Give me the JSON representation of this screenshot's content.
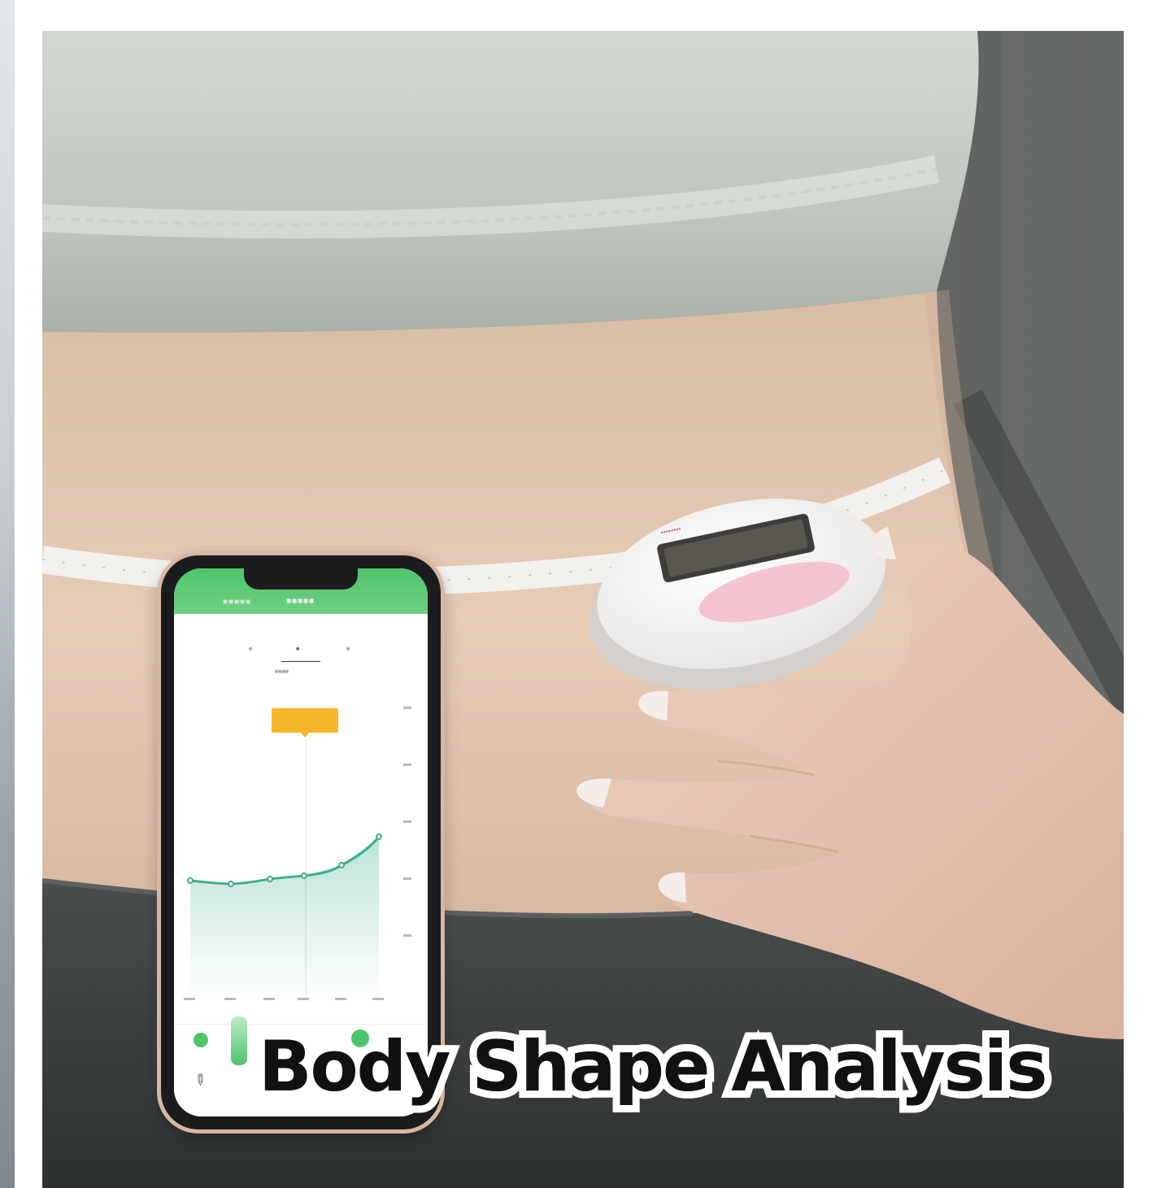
{
  "caption": "Body Shape Analysis",
  "colors": {
    "caption_text": "#111111",
    "caption_outline": "#ffffff",
    "app_header": "#4fc46b",
    "chart_line": "#3fae8f",
    "tooltip": "#f5b52a",
    "device_body": "#f4f2f1",
    "device_accent": "#f3c3cf"
  },
  "icons": [
    "pencil-icon"
  ]
}
